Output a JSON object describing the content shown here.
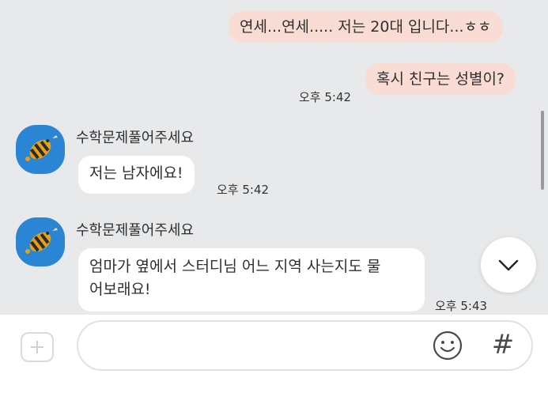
{
  "messages": {
    "out1": {
      "text": "연세...연세..... 저는 20대 입니다...ㅎㅎ"
    },
    "out2": {
      "text": "혹시 친구는 성별이?",
      "time": "오후 5:42"
    },
    "in1": {
      "sender": "수학문제풀어주세요",
      "text": "저는 남자에요!",
      "time": "오후 5:42"
    },
    "in2": {
      "sender": "수학문제풀어주세요",
      "line1": "엄마가 옆에서 스터디님 어느 지역 사는지도 물",
      "line2": "어보래요!",
      "time": "오후 5:43"
    }
  },
  "composer": {
    "value": "",
    "placeholder": "",
    "hash_label": "#"
  },
  "icons": {
    "avatar": "cartoon-avatar",
    "scroll_down": "chevron-down-icon",
    "add": "plus-icon",
    "emoji": "smiley-icon",
    "hash": "hash-icon"
  },
  "colors": {
    "chat_background": "#e8e9eb",
    "outgoing_bubble": "#f9dcd3",
    "incoming_bubble": "#ffffff",
    "avatar_background": "#2a86d4"
  }
}
